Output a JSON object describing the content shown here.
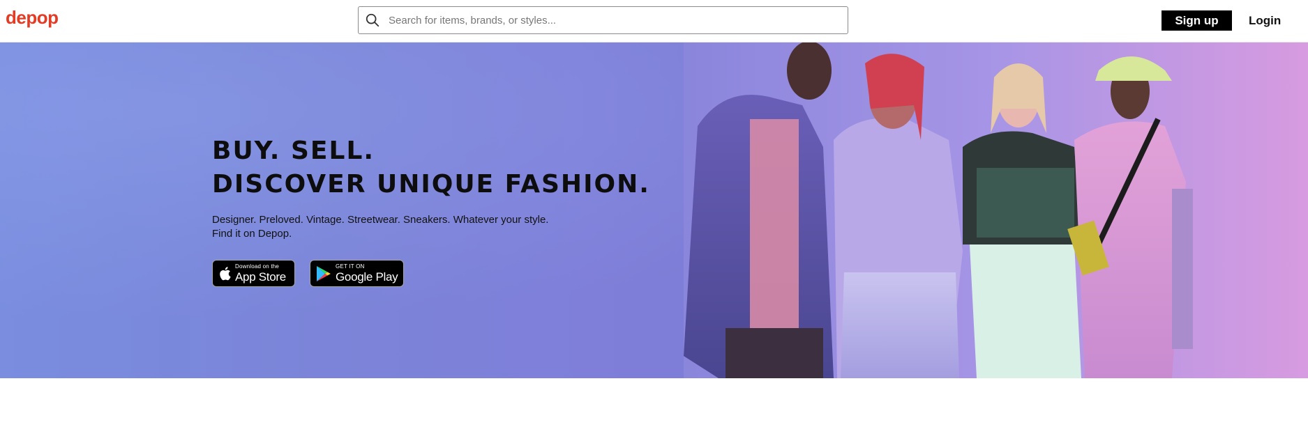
{
  "header": {
    "logo": "depop",
    "search_placeholder": "Search for items, brands, or styles...",
    "signup_label": "Sign up",
    "login_label": "Login"
  },
  "hero": {
    "headline_line1": "BUY. SELL.",
    "headline_line2": "DISCOVER UNIQUE FASHION.",
    "subtitle": "Designer. Preloved. Vintage. Streetwear. Sneakers. Whatever your style. Find it on Depop.",
    "app_store": {
      "small": "Download on the",
      "big": "App Store"
    },
    "google_play": {
      "small": "GET IT ON",
      "big": "Google Play"
    }
  },
  "colors": {
    "brand": "#e33b24",
    "hero_bg": "#7d84d9",
    "button_bg": "#000000"
  },
  "icons": [
    "search-icon",
    "apple-icon",
    "google-play-icon"
  ]
}
